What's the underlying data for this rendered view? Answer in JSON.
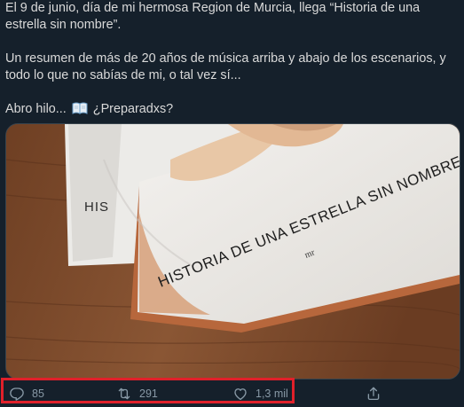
{
  "tweet": {
    "line1": "El 9 de junio, día de mi hermosa Region de Murcia, llega “Historia de una estrella sin nombre”.",
    "line2": "Un resumen de más de 20 años de música arriba y abajo de los escenarios, y todo lo que no sabías de mi, o tal vez sí...",
    "line3_a": "Abro hilo...",
    "line3_b": "¿Preparadxs?"
  },
  "media": {
    "book_title": "HISTORIA DE UNA ESTRELLA SIN NOMBRE",
    "back_book_text": "HIS",
    "publisher_logo": "mr"
  },
  "actions": {
    "reply_count": "85",
    "retweet_count": "291",
    "like_count": "1,3 mil"
  },
  "icons": {
    "reply": "reply-icon",
    "retweet": "retweet-icon",
    "like": "heart-icon",
    "share": "share-icon",
    "book": "open-book-icon"
  },
  "colors": {
    "background": "#15202b",
    "text": "#d9d9d9",
    "muted": "#8899a6",
    "highlight": "#e0202a"
  }
}
